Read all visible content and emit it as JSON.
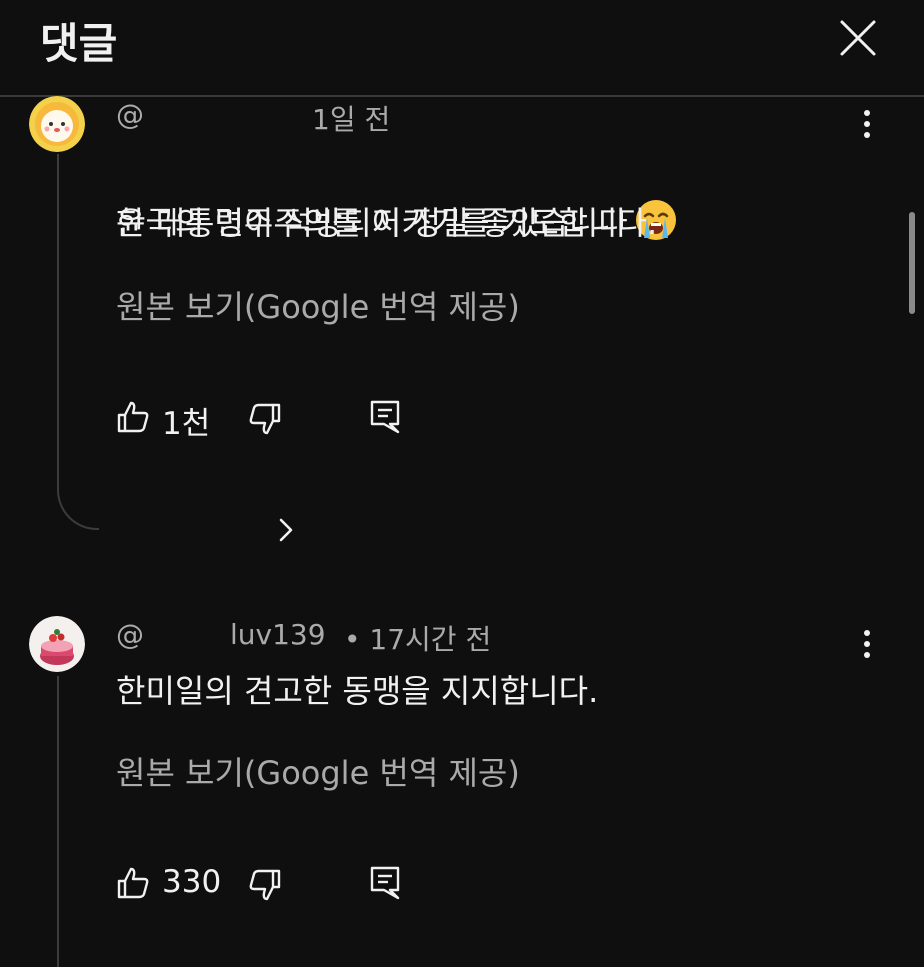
{
  "header": {
    "title": "댓글",
    "close_icon": "close-icon"
  },
  "comments": [
    {
      "handle_visible": "@",
      "timestamp": "1일 전",
      "text": "윤 대통령이 석방되어 정말 좋았습니다",
      "emoji": "😭",
      "text2": "한국의 민주주의를 지키기를 기도합니다.",
      "translate": "원본 보기(Google 번역 제공)",
      "likes": "1천"
    },
    {
      "handle_visible": "@",
      "handle_tail": "luv139",
      "timestamp": "• 17시간 전",
      "text": "한미일의 견고한 동맹을 지지합니다.",
      "translate": "원본 보기(Google 번역 제공)",
      "likes": "330"
    }
  ],
  "colors": {
    "background": "#0f0f0f",
    "text": "#f1f1f1",
    "secondary": "#aaaaaa",
    "divider": "#3a3a3a"
  }
}
